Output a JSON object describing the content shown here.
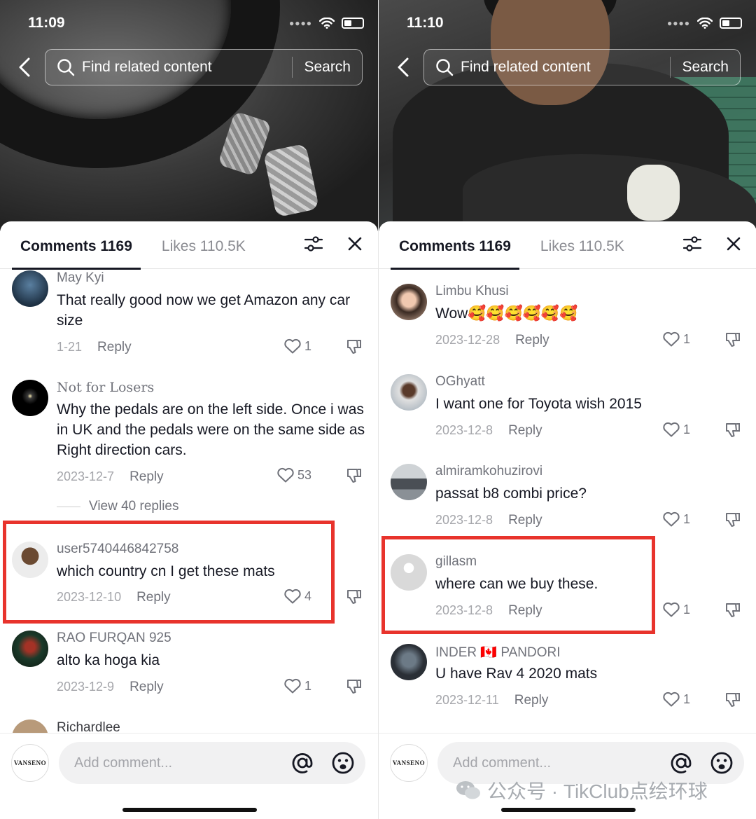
{
  "left": {
    "status": {
      "time": "11:09"
    },
    "search": {
      "placeholder": "Find related content",
      "button": "Search"
    },
    "tabs": {
      "comments": "Comments 1169",
      "likes": "Likes 110.5K"
    },
    "comments": [
      {
        "user": "May Kyi",
        "text": "That really good now we get Amazon any car size",
        "date": "1-21",
        "reply": "Reply",
        "likes": "1"
      },
      {
        "user": "Not for Losers",
        "text": "Why the pedals are on the left side. Once i was in UK and the pedals were on the same side as Right direction cars.",
        "date": "2023-12-7",
        "reply": "Reply",
        "likes": "53",
        "view_replies": "View 40 replies"
      },
      {
        "user": "user5740446842758",
        "text": "which country cn I get these mats",
        "date": "2023-12-10",
        "reply": "Reply",
        "likes": "4"
      },
      {
        "user": "RAO FURQAN 925",
        "text": "alto ka hoga kia",
        "date": "2023-12-9",
        "reply": "Reply",
        "likes": "1"
      },
      {
        "user": "Richardlee"
      }
    ],
    "composer": {
      "placeholder": "Add comment...",
      "avatar_text": "VANSENO"
    }
  },
  "right": {
    "status": {
      "time": "11:10"
    },
    "search": {
      "placeholder": "Find related content",
      "button": "Search"
    },
    "tabs": {
      "comments": "Comments 1169",
      "likes": "Likes 110.5K"
    },
    "comments": [
      {
        "user": "Limbu Khusi",
        "text": "Wow🥰🥰🥰🥰🥰🥰",
        "date": "2023-12-28",
        "reply": "Reply",
        "likes": "1"
      },
      {
        "user": "OGhyatt",
        "text": "I want one for Toyota wish 2015",
        "date": "2023-12-8",
        "reply": "Reply",
        "likes": "1"
      },
      {
        "user": "almiramkohuzirovi",
        "text": "passat b8 combi price?",
        "date": "2023-12-8",
        "reply": "Reply",
        "likes": "1"
      },
      {
        "user": "gillasm",
        "text": "where can we buy these.",
        "date": "2023-12-8",
        "reply": "Reply",
        "likes": "1"
      },
      {
        "user": "INDER 🇨🇦 PANDORI",
        "text": "U have Rav 4 2020 mats",
        "date": "2023-12-11",
        "reply": "Reply",
        "likes": "1"
      }
    ],
    "composer": {
      "placeholder": "Add comment...",
      "avatar_text": "VANSENO"
    }
  },
  "watermark": "公众号 · TikClub点绘环球",
  "colors": {
    "highlight": "#e8332c",
    "text": "#161823",
    "muted": "#a4a5aa"
  }
}
